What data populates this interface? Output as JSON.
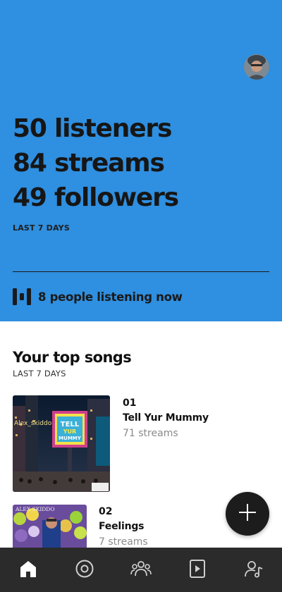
{
  "header": {
    "avatar_icon": "user-avatar",
    "stats": {
      "listeners": "50 listeners",
      "streams": "84 streams",
      "followers": "49 followers"
    },
    "period": "LAST 7 DAYS",
    "live": {
      "icon": "live-listening-icon",
      "text": "8 people listening now"
    }
  },
  "top_songs": {
    "title": "Your top songs",
    "subtitle": "LAST 7 DAYS",
    "items": [
      {
        "rank": "01",
        "title": "Tell Yur Mummy",
        "streams": "71 streams",
        "art_caption": "Alex_skiddo",
        "billboard_text": "TELL YUR MUMMY"
      },
      {
        "rank": "02",
        "title": "Feelings",
        "streams": "7 streams",
        "art_caption": "ALEX SKIDDO"
      }
    ]
  },
  "fab": {
    "icon": "plus-icon"
  },
  "nav": {
    "items": [
      {
        "icon": "home-icon",
        "active": true
      },
      {
        "icon": "music-disc-icon",
        "active": false
      },
      {
        "icon": "audience-icon",
        "active": false
      },
      {
        "icon": "video-icon",
        "active": false
      },
      {
        "icon": "artist-profile-icon",
        "active": false
      }
    ]
  },
  "colors": {
    "hero_bg": "#2f8fe0",
    "nav_bg": "#2b2b2b",
    "fab_bg": "#1c1c1c",
    "muted_text": "#8a8a8a"
  }
}
